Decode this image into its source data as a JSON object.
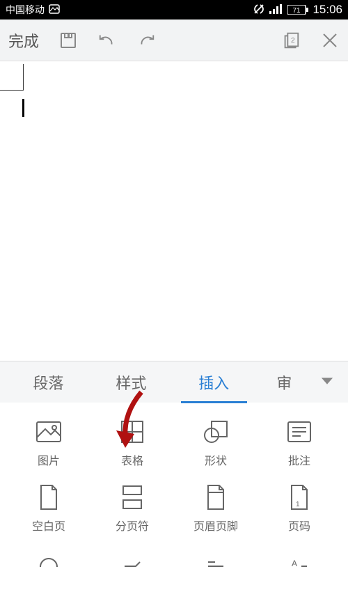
{
  "status": {
    "carrier": "中国移动",
    "battery": "71",
    "time": "15:06"
  },
  "toolbar": {
    "done": "完成",
    "page_count": "2"
  },
  "tabs": {
    "paragraph": "段落",
    "style": "样式",
    "insert": "插入",
    "review": "审"
  },
  "insert": {
    "image": "图片",
    "table": "表格",
    "shape": "形状",
    "comment": "批注",
    "blank": "空白页",
    "pagebreak": "分页符",
    "headerfooter": "页眉页脚",
    "pagenumber": "页码"
  }
}
